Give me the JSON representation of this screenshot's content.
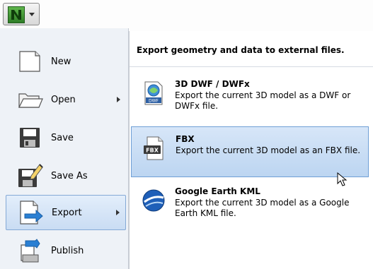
{
  "menu": {
    "items": [
      {
        "label": "New",
        "icon": "new-document-icon",
        "has_submenu": false,
        "selected": false
      },
      {
        "label": "Open",
        "icon": "open-folder-icon",
        "has_submenu": true,
        "selected": false
      },
      {
        "label": "Save",
        "icon": "save-disk-icon",
        "has_submenu": false,
        "selected": false
      },
      {
        "label": "Save As",
        "icon": "save-as-icon",
        "has_submenu": false,
        "selected": false
      },
      {
        "label": "Export",
        "icon": "export-icon",
        "has_submenu": true,
        "selected": true
      },
      {
        "label": "Publish",
        "icon": "publish-icon",
        "has_submenu": false,
        "selected": false
      }
    ]
  },
  "panel": {
    "title": "Export geometry and data to external files.",
    "options": [
      {
        "title": "3D DWF / DWFx",
        "desc": "Export the current 3D model as a DWF or DWFx file.",
        "icon": "dwf-file-icon",
        "icon_text": "DWF",
        "selected": false
      },
      {
        "title": "FBX",
        "desc": "Export the current 3D model as an FBX file.",
        "icon": "fbx-file-icon",
        "icon_text": "FBX",
        "selected": true
      },
      {
        "title": "Google Earth KML",
        "desc": "Export the current 3D model as a Google Earth KML file.",
        "icon": "google-earth-icon",
        "selected": false
      }
    ]
  },
  "colors": {
    "selection_fill": "#c9dcf3",
    "selection_border": "#6f9fd6",
    "export_arrow": "#2a7fd3"
  }
}
